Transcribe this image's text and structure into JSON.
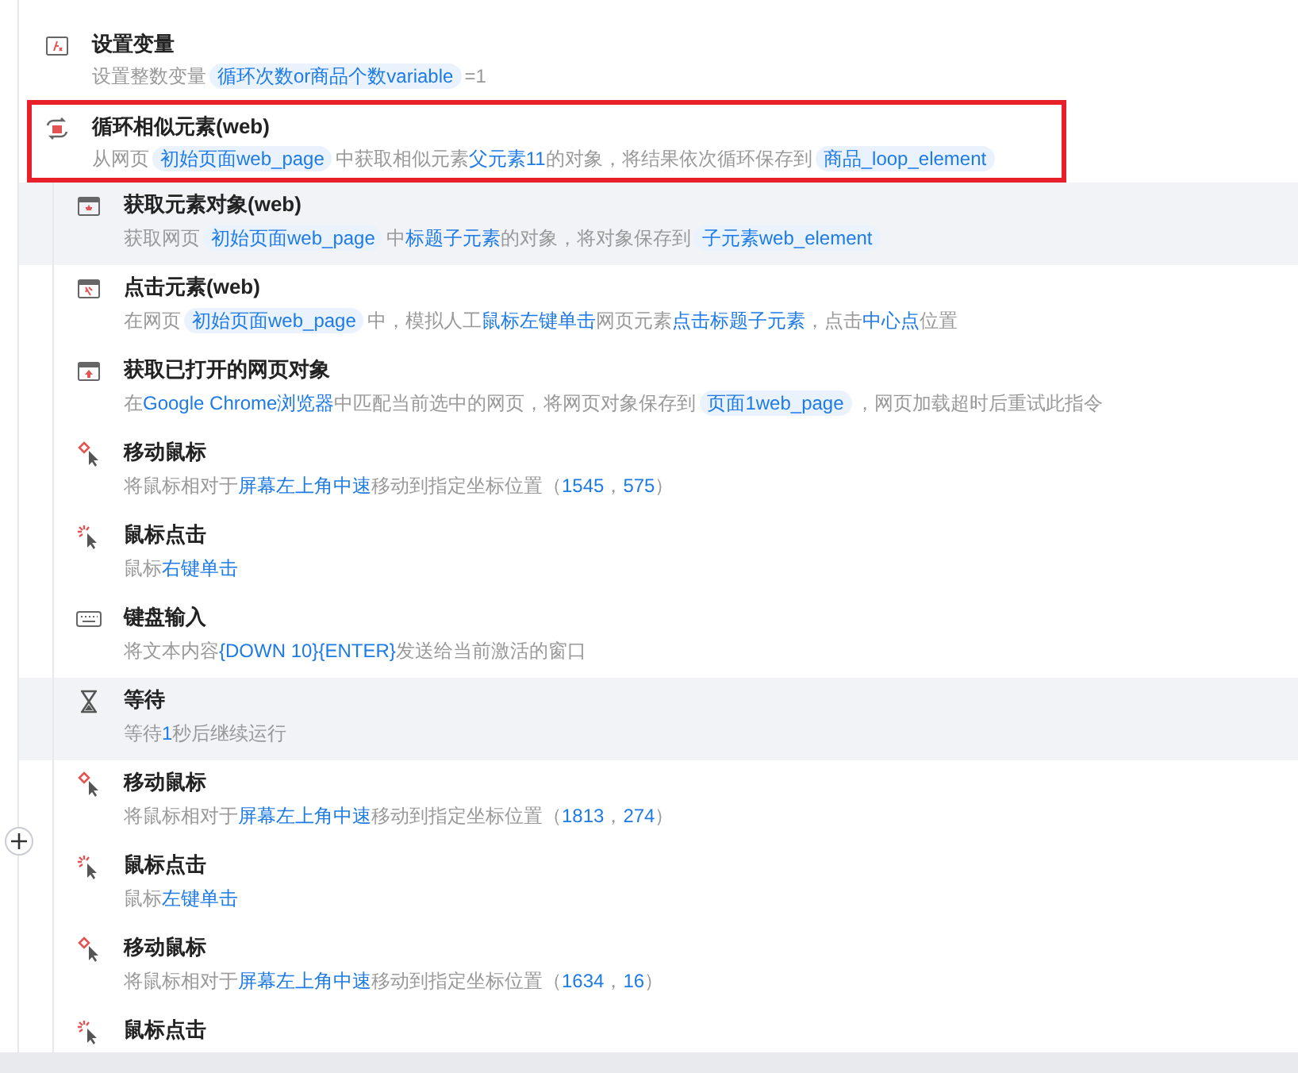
{
  "steps": [
    {
      "kind": "variable",
      "title": "设置变量",
      "selected": false,
      "description": [
        {
          "kind": "text",
          "text": "设置整数变量"
        },
        {
          "kind": "chip",
          "text": "循环次数or商品个数variable"
        },
        {
          "kind": "text",
          "text": "=1"
        }
      ]
    },
    {
      "kind": "loop",
      "title": "循环相似元素(web)",
      "selected": true,
      "description": [
        {
          "kind": "text",
          "text": "从网页"
        },
        {
          "kind": "chip",
          "text": "初始页面web_page"
        },
        {
          "kind": "text",
          "text": "中获取相似元素"
        },
        {
          "kind": "link",
          "text": "父元素11"
        },
        {
          "kind": "text",
          "text": "的对象，将结果依次循环保存到"
        },
        {
          "kind": "chip",
          "text": "商品_loop_element"
        }
      ],
      "children": [
        {
          "kind": "web-element",
          "title": "获取元素对象(web)",
          "highlighted": true,
          "description": [
            {
              "kind": "text",
              "text": "获取网页"
            },
            {
              "kind": "chip",
              "text": "初始页面web_page"
            },
            {
              "kind": "text",
              "text": "中"
            },
            {
              "kind": "link",
              "text": "标题子元素"
            },
            {
              "kind": "text",
              "text": "的对象，将对象保存到"
            },
            {
              "kind": "chip",
              "text": "子元素web_element"
            }
          ]
        },
        {
          "kind": "click-element",
          "title": "点击元素(web)",
          "highlighted": false,
          "description": [
            {
              "kind": "text",
              "text": "在网页"
            },
            {
              "kind": "chip",
              "text": "初始页面web_page"
            },
            {
              "kind": "text",
              "text": "中，模拟人工"
            },
            {
              "kind": "link",
              "text": "鼠标左键单击"
            },
            {
              "kind": "text",
              "text": "网页元素"
            },
            {
              "kind": "link",
              "text": "点击标题子元素"
            },
            {
              "kind": "text",
              "text": "，点击"
            },
            {
              "kind": "link",
              "text": "中心点"
            },
            {
              "kind": "text",
              "text": "位置"
            }
          ]
        },
        {
          "kind": "web-page",
          "title": "获取已打开的网页对象",
          "highlighted": false,
          "description": [
            {
              "kind": "text",
              "text": "在"
            },
            {
              "kind": "link",
              "text": "Google Chrome浏览器"
            },
            {
              "kind": "text",
              "text": "中匹配当前选中的网页，将网页对象保存到"
            },
            {
              "kind": "chip",
              "text": "页面1web_page"
            },
            {
              "kind": "text",
              "text": "，网页加载超时后重试此指令"
            }
          ]
        },
        {
          "kind": "mouse-move",
          "title": "移动鼠标",
          "highlighted": false,
          "description": [
            {
              "kind": "text",
              "text": "将鼠标相对于"
            },
            {
              "kind": "link",
              "text": "屏幕左上角"
            },
            {
              "kind": "link",
              "text": "中速"
            },
            {
              "kind": "text",
              "text": "移动到指定坐标位置（"
            },
            {
              "kind": "link",
              "text": "1545"
            },
            {
              "kind": "text",
              "text": "，"
            },
            {
              "kind": "link",
              "text": "575"
            },
            {
              "kind": "text",
              "text": "）"
            }
          ]
        },
        {
          "kind": "mouse-click",
          "title": "鼠标点击",
          "highlighted": false,
          "description": [
            {
              "kind": "text",
              "text": "鼠标"
            },
            {
              "kind": "link",
              "text": "右键单击"
            }
          ]
        },
        {
          "kind": "keyboard",
          "title": "键盘输入",
          "highlighted": false,
          "description": [
            {
              "kind": "text",
              "text": "将文本内容"
            },
            {
              "kind": "link",
              "text": "{DOWN 10}{ENTER}"
            },
            {
              "kind": "text",
              "text": "发送给当前激活的窗口"
            }
          ]
        },
        {
          "kind": "wait",
          "title": "等待",
          "highlighted": true,
          "description": [
            {
              "kind": "text",
              "text": "等待"
            },
            {
              "kind": "link",
              "text": "1"
            },
            {
              "kind": "text",
              "text": "秒后继续运行"
            }
          ]
        },
        {
          "kind": "mouse-move",
          "title": "移动鼠标",
          "highlighted": false,
          "description": [
            {
              "kind": "text",
              "text": "将鼠标相对于"
            },
            {
              "kind": "link",
              "text": "屏幕左上角"
            },
            {
              "kind": "link",
              "text": "中速"
            },
            {
              "kind": "text",
              "text": "移动到指定坐标位置（"
            },
            {
              "kind": "link",
              "text": "1813"
            },
            {
              "kind": "text",
              "text": "，"
            },
            {
              "kind": "link",
              "text": "274"
            },
            {
              "kind": "text",
              "text": "）"
            }
          ]
        },
        {
          "kind": "mouse-click",
          "title": "鼠标点击",
          "highlighted": false,
          "description": [
            {
              "kind": "text",
              "text": "鼠标"
            },
            {
              "kind": "link",
              "text": "左键单击"
            }
          ]
        },
        {
          "kind": "mouse-move",
          "title": "移动鼠标",
          "highlighted": false,
          "description": [
            {
              "kind": "text",
              "text": "将鼠标相对于"
            },
            {
              "kind": "link",
              "text": "屏幕左上角"
            },
            {
              "kind": "link",
              "text": "中速"
            },
            {
              "kind": "text",
              "text": "移动到指定坐标位置（"
            },
            {
              "kind": "link",
              "text": "1634"
            },
            {
              "kind": "text",
              "text": "，"
            },
            {
              "kind": "link",
              "text": "16"
            },
            {
              "kind": "text",
              "text": "）"
            }
          ]
        },
        {
          "kind": "mouse-click",
          "title": "鼠标点击",
          "highlighted": false
        }
      ]
    }
  ]
}
